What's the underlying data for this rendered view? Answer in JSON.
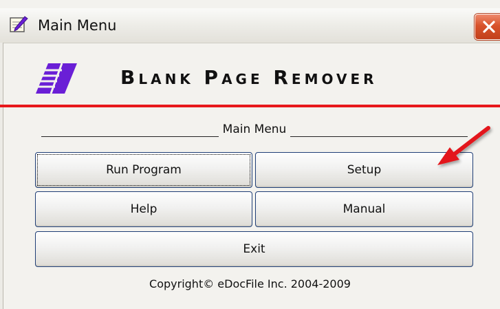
{
  "window": {
    "title": "Main Menu",
    "close_label": "Close"
  },
  "app": {
    "title": "Blank Page Remover"
  },
  "menu": {
    "heading": "Main Menu",
    "buttons": {
      "run_program": "Run Program",
      "setup": "Setup",
      "help": "Help",
      "manual": "Manual",
      "exit": "Exit"
    }
  },
  "footer": {
    "copyright": "Copyright© eDocFile Inc. 2004-2009"
  },
  "colors": {
    "accent_red": "#e8181b",
    "logo_purple": "#6a1fd6",
    "button_border": "#1e3d75"
  },
  "icons": {
    "titlebar": "notepad-pencil-icon",
    "close": "close-x-icon",
    "logo": "blank-page-remover-logo",
    "annotation": "red-arrow-annotation"
  }
}
